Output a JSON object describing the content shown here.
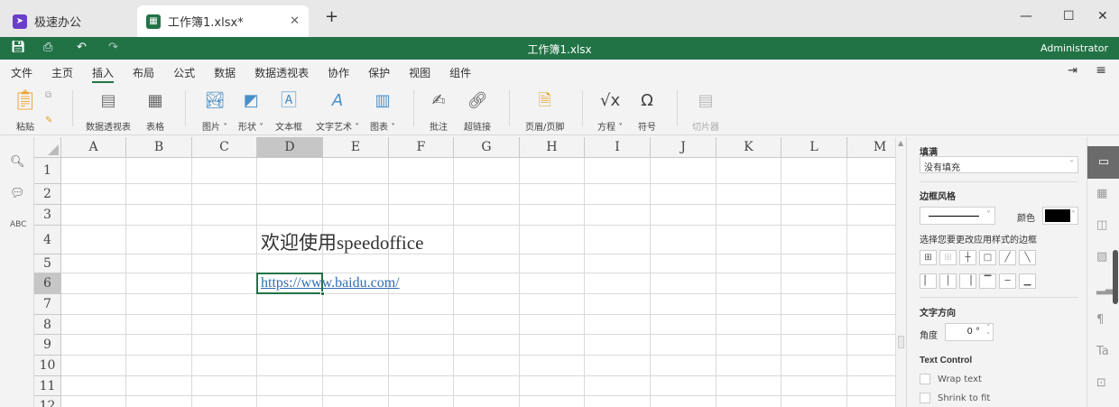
{
  "tabs": [
    {
      "label": "极速办公"
    },
    {
      "label": "工作簿1.xlsx*",
      "active": true
    }
  ],
  "title": "工作簿1.xlsx",
  "user": "Administrator",
  "menu": [
    "文件",
    "主页",
    "插入",
    "布局",
    "公式",
    "数据",
    "数据透视表",
    "协作",
    "保护",
    "视图",
    "组件"
  ],
  "active_menu": "插入",
  "ribbon": {
    "paste": "粘贴",
    "pivot": "数据透视表",
    "table": "表格",
    "picture": "图片",
    "shape": "形状",
    "textbox": "文本框",
    "wordart": "文字艺术",
    "chart": "图表",
    "comment": "批注",
    "hyperlink": "超链接",
    "header_footer": "页眉/页脚",
    "equation": "方程",
    "symbol": "符号",
    "slicer": "切片器"
  },
  "columns": [
    "A",
    "B",
    "C",
    "D",
    "E",
    "F",
    "G",
    "H",
    "I",
    "J",
    "K",
    "L",
    "M"
  ],
  "rows": [
    "1",
    "2",
    "3",
    "4",
    "5",
    "6",
    "7",
    "8",
    "9",
    "10",
    "11",
    "12"
  ],
  "cells": {
    "D4": "欢迎使用speedoffice",
    "D6": "https://www.baidu.com/"
  },
  "selected_cell": "D6",
  "panel": {
    "fill_label": "填满",
    "fill_value": "没有填充",
    "border_style": "边框风格",
    "color": "颜色",
    "border_hint": "选择您要更改应用样式的边框",
    "text_direction": "文字方向",
    "angle_label": "角度",
    "angle_value": "0 °",
    "text_control": "Text Control",
    "wrap": "Wrap text",
    "shrink": "Shrink to fit"
  },
  "colors": {
    "brand": "#217346",
    "link": "#2f6db5"
  }
}
